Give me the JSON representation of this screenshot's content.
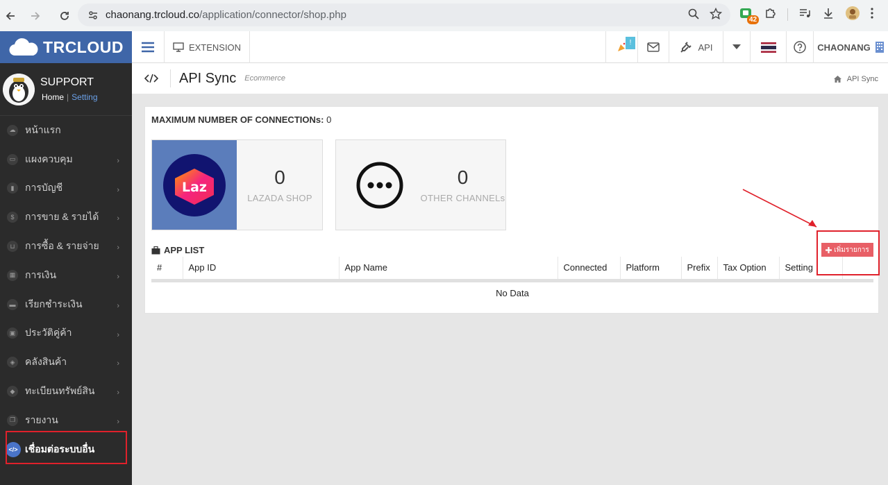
{
  "browser": {
    "url_host": "chaonang.trcloud.co",
    "url_path": "/application/connector/shop.php",
    "ext_badge": "42"
  },
  "sidebar": {
    "brand": "TRCLOUD",
    "user": "SUPPORT",
    "link_home": "Home",
    "link_sep": "|",
    "link_setting": "Setting",
    "items": [
      {
        "label": "หน้าแรก",
        "icon": "cloud-icon",
        "chevron": false
      },
      {
        "label": "แผงควบคุม",
        "icon": "monitor-icon",
        "chevron": true
      },
      {
        "label": "การบัญชี",
        "icon": "book-icon",
        "chevron": true
      },
      {
        "label": "การขาย & รายได้",
        "icon": "dollar-icon",
        "chevron": true
      },
      {
        "label": "การซื้อ & รายจ่าย",
        "icon": "cart-icon",
        "chevron": true
      },
      {
        "label": "การเงิน",
        "icon": "calendar-icon",
        "chevron": true
      },
      {
        "label": "เรียกชำระเงิน",
        "icon": "credit-card-icon",
        "chevron": true
      },
      {
        "label": "ประวัติคู่ค้า",
        "icon": "contact-icon",
        "chevron": true
      },
      {
        "label": "คลังสินค้า",
        "icon": "cubes-icon",
        "chevron": true
      },
      {
        "label": "ทะเบียนทรัพย์สิน",
        "icon": "diamond-icon",
        "chevron": true
      },
      {
        "label": "รายงาน",
        "icon": "copy-icon",
        "chevron": true
      },
      {
        "label": "เชื่อมต่อระบบอื่น",
        "icon": "code-icon",
        "chevron": false,
        "active": true
      }
    ]
  },
  "topbar": {
    "extension": "EXTENSION",
    "notif_badge": "!",
    "api": "API",
    "company": "CHAONANG"
  },
  "page": {
    "title": "API Sync",
    "subtitle": "Ecommerce",
    "breadcrumb": "API Sync"
  },
  "content": {
    "max_label": "MAXIMUM NUMBER OF CONNECTIONs:",
    "max_value": "0",
    "cards": [
      {
        "count": "0",
        "label": "LAZADA SHOP",
        "logo_text": "Laz"
      },
      {
        "count": "0",
        "label": "OTHER CHANNELs"
      }
    ],
    "applist_title": "APP LIST",
    "add_button": "เพิ่มรายการ",
    "columns": [
      "#",
      "App ID",
      "App Name",
      "Connected",
      "Platform",
      "Prefix",
      "Tax Option",
      "Setting",
      ""
    ],
    "empty_text": "No Data"
  },
  "colors": {
    "brand_blue": "#3f66a8",
    "sidebar_bg": "#2b2b2b",
    "add_button": "#e85f66",
    "highlight": "#e0212b"
  }
}
